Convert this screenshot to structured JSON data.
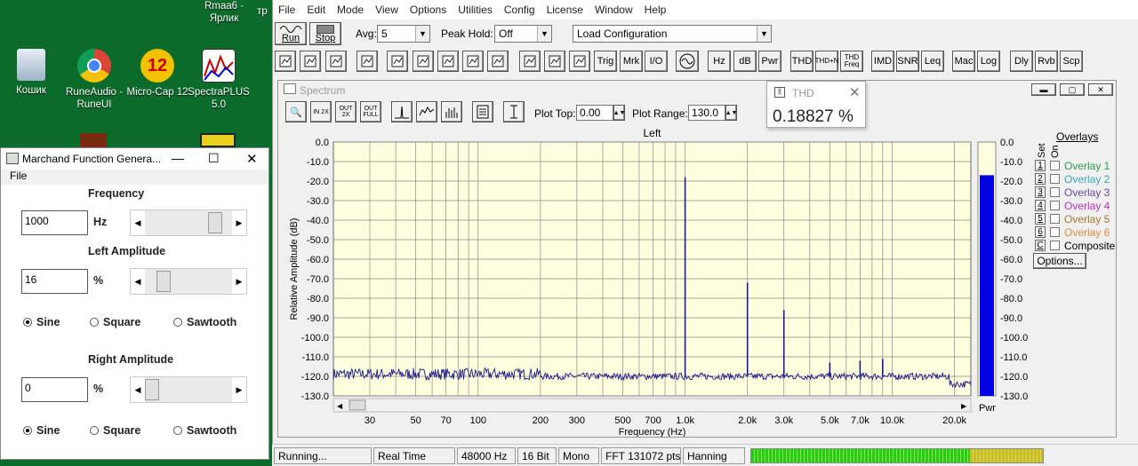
{
  "desktop": {
    "icons": [
      {
        "label": "Кошик"
      },
      {
        "label": "RuneAudio - RuneUI"
      },
      {
        "label": "Micro-Cap 12"
      },
      {
        "label": "SpectraPLUS 5.0"
      },
      {
        "label": "Rmaa6 - Ярлик"
      }
    ],
    "partial": "тр"
  },
  "app": {
    "menu": [
      "File",
      "Edit",
      "Mode",
      "View",
      "Options",
      "Utilities",
      "Config",
      "License",
      "Window",
      "Help"
    ],
    "run": "Run",
    "stop": "Stop",
    "avg_label": "Avg:",
    "avg_value": "5",
    "peak_label": "Peak Hold:",
    "peak_value": "Off",
    "config_value": "Load Configuration",
    "toolbar2": [
      "Trig",
      "Mrk",
      "I/O",
      "Hz",
      "dB",
      "Pwr",
      "THD",
      "THD+N",
      "THD Freq",
      "IMD",
      "SNR",
      "Leq",
      "Mac",
      "Log",
      "Dly",
      "Rvb",
      "Scp"
    ]
  },
  "spectrum": {
    "title": "Spectrum",
    "plot_top_label": "Plot Top:",
    "plot_top_value": "0.00",
    "plot_range_label": "Plot Range:",
    "plot_range_value": "130.0",
    "zoom_labels": [
      "IN 2X",
      "OUT 2X",
      "OUT FULL"
    ],
    "overlays_title": "Overlays",
    "set_label": "Set",
    "on_label": "On",
    "overlays": [
      {
        "n": "1",
        "name": "Overlay 1",
        "color": "#2a9d4a"
      },
      {
        "n": "2",
        "name": "Overlay 2",
        "color": "#3aa6b9"
      },
      {
        "n": "3",
        "name": "Overlay 3",
        "color": "#6a4aa6"
      },
      {
        "n": "4",
        "name": "Overlay 4",
        "color": "#c030c0"
      },
      {
        "n": "5",
        "name": "Overlay 5",
        "color": "#a07a2a"
      },
      {
        "n": "6",
        "name": "Overlay 6",
        "color": "#e08a3a"
      },
      {
        "n": "C",
        "name": "Composite",
        "color": "#000000"
      }
    ],
    "options_button": "Options...",
    "pwr_label": "Pwr"
  },
  "thd_popup": {
    "title": "THD",
    "value": "0.18827 %"
  },
  "chart_data": {
    "type": "line",
    "title": "Left",
    "xlabel": "Frequency (Hz)",
    "ylabel": "Relative Amplitude (dB)",
    "x_scale": "log",
    "xlim": [
      20,
      24000
    ],
    "ylim": [
      -130,
      0
    ],
    "grid": true,
    "x_ticks": [
      "30",
      "50",
      "70",
      "100",
      "200",
      "300",
      "500",
      "700",
      "1.0k",
      "2.0k",
      "3.0k",
      "5.0k",
      "7.0k",
      "10.0k",
      "20.0k"
    ],
    "x_tick_values": [
      30,
      50,
      70,
      100,
      200,
      300,
      500,
      700,
      1000,
      2000,
      3000,
      5000,
      7000,
      10000,
      20000
    ],
    "y_ticks": [
      "0.0",
      "-10.0",
      "-20.0",
      "-30.0",
      "-40.0",
      "-50.0",
      "-60.0",
      "-70.0",
      "-80.0",
      "-90.0",
      "-100.0",
      "-110.0",
      "-120.0",
      "-130.0"
    ],
    "noise_floor_db": -120,
    "peaks": [
      {
        "x": 1000,
        "y": -18
      },
      {
        "x": 2000,
        "y": -72
      },
      {
        "x": 3000,
        "y": -86
      },
      {
        "x": 5000,
        "y": -113
      },
      {
        "x": 7000,
        "y": -112
      },
      {
        "x": 9000,
        "y": -111
      }
    ],
    "meter": {
      "label": "Pwr",
      "value_db": -17,
      "ticks": [
        "0.0",
        "-10.0",
        "-20.0",
        "-30.0",
        "-40.0",
        "-50.0",
        "-60.0",
        "-70.0",
        "-80.0",
        "-90.0",
        "-100.0",
        "-110.0",
        "-120.0",
        "-130.0"
      ]
    }
  },
  "status": {
    "cells": [
      "Running...",
      "Real Time",
      "48000 Hz",
      "16 Bit",
      "Mono",
      "FFT 131072 pts",
      "Hanning"
    ],
    "level_fraction": 1.0
  },
  "funcgen": {
    "title": "Marchand Function Genera...",
    "menu": "File",
    "frequency_label": "Frequency",
    "frequency_value": "1000",
    "frequency_unit": "Hz",
    "frequency_position": 0.85,
    "left_label": "Left Amplitude",
    "left_value": "16",
    "left_unit": "%",
    "left_position": 0.16,
    "right_label": "Right Amplitude",
    "right_value": "0",
    "right_unit": "%",
    "right_position": 0.0,
    "wave_options": [
      "Sine",
      "Square",
      "Sawtooth"
    ]
  }
}
